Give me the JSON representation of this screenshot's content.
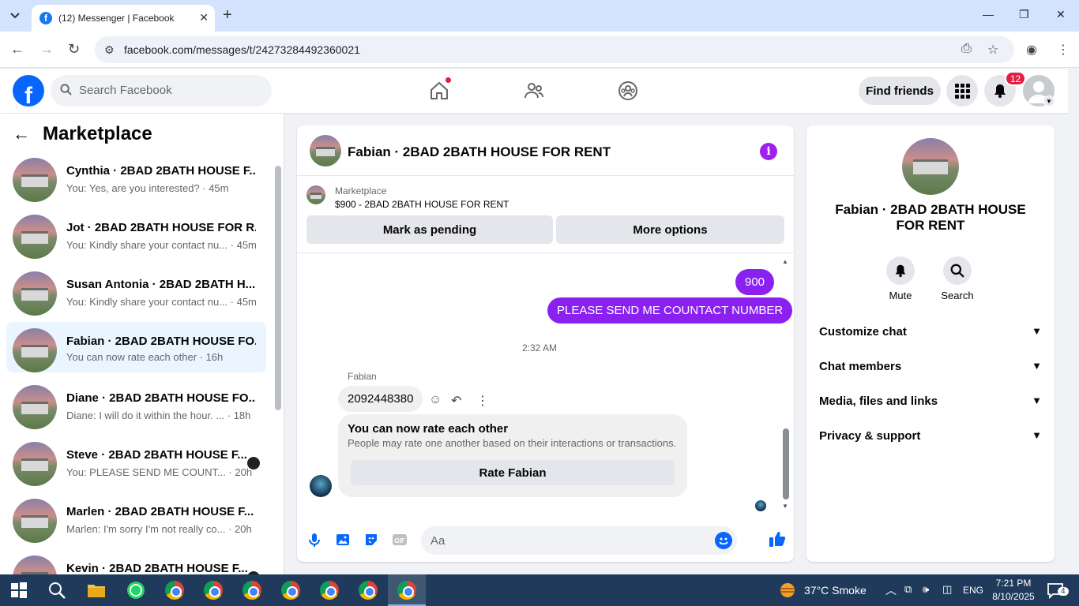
{
  "browser": {
    "tab_title": "(12) Messenger | Facebook",
    "url": "facebook.com/messages/t/24273284492360021"
  },
  "header": {
    "search_placeholder": "Search Facebook",
    "find_friends_label": "Find friends",
    "notifications_count": "12"
  },
  "sidebar": {
    "title": "Marketplace",
    "conversations": [
      {
        "name": "Cynthia · 2BAD 2BATH HOUSE F...",
        "snippet": "You: Yes, are you interested? · 45m"
      },
      {
        "name": "Jot · 2BAD 2BATH HOUSE FOR R...",
        "snippet": "You: Kindly share your contact nu...  · 45m"
      },
      {
        "name": "Susan Antonia · 2BAD 2BATH H...",
        "snippet": "You: Kindly share your contact nu...  · 45m"
      },
      {
        "name": "Fabian · 2BAD 2BATH HOUSE FO...",
        "snippet": "You can now rate each other · 16h"
      },
      {
        "name": "Diane · 2BAD 2BATH HOUSE FO...",
        "snippet": "Diane: I will do it within the hour. ...  · 18h"
      },
      {
        "name": "Steve · 2BAD 2BATH HOUSE F...",
        "snippet": "You: PLEASE SEND ME COUNT...   · 20h"
      },
      {
        "name": "Marlen · 2BAD 2BATH HOUSE F...",
        "snippet": "Marlen: I'm sorry I'm not really co...  · 20h"
      },
      {
        "name": "Kevin · 2BAD 2BATH HOUSE F...",
        "snippet": ""
      }
    ]
  },
  "chat": {
    "title": "Fabian · 2BAD 2BATH HOUSE FOR RENT",
    "marketplace_label": "Marketplace",
    "listing": "$900 - 2BAD 2BATH HOUSE FOR RENT",
    "mark_pending_label": "Mark as pending",
    "more_options_label": "More options",
    "messages": {
      "out1": "900",
      "out2": "PLEASE SEND  ME COUNTACT NUMBER",
      "timestamp": "2:32 AM",
      "sender": "Fabian",
      "in1": "2092448380"
    },
    "rate_card": {
      "title": "You can now rate each other",
      "subtitle": "People may rate one another based on their interactions or transactions.",
      "button": "Rate Fabian"
    },
    "composer_placeholder": "Aa"
  },
  "details": {
    "name": "Fabian · 2BAD 2BATH HOUSE FOR RENT",
    "mute_label": "Mute",
    "search_label": "Search",
    "sections": [
      "Customize chat",
      "Chat members",
      "Media, files and links",
      "Privacy & support"
    ]
  },
  "taskbar": {
    "weather": "37°C  Smoke",
    "lang": "ENG",
    "time": "7:21 PM",
    "date": "8/10/2025",
    "notif": "4"
  },
  "colors": {
    "accent": "#8a21f0",
    "fb_blue": "#0866ff",
    "active_row": "#ebf5ff"
  }
}
